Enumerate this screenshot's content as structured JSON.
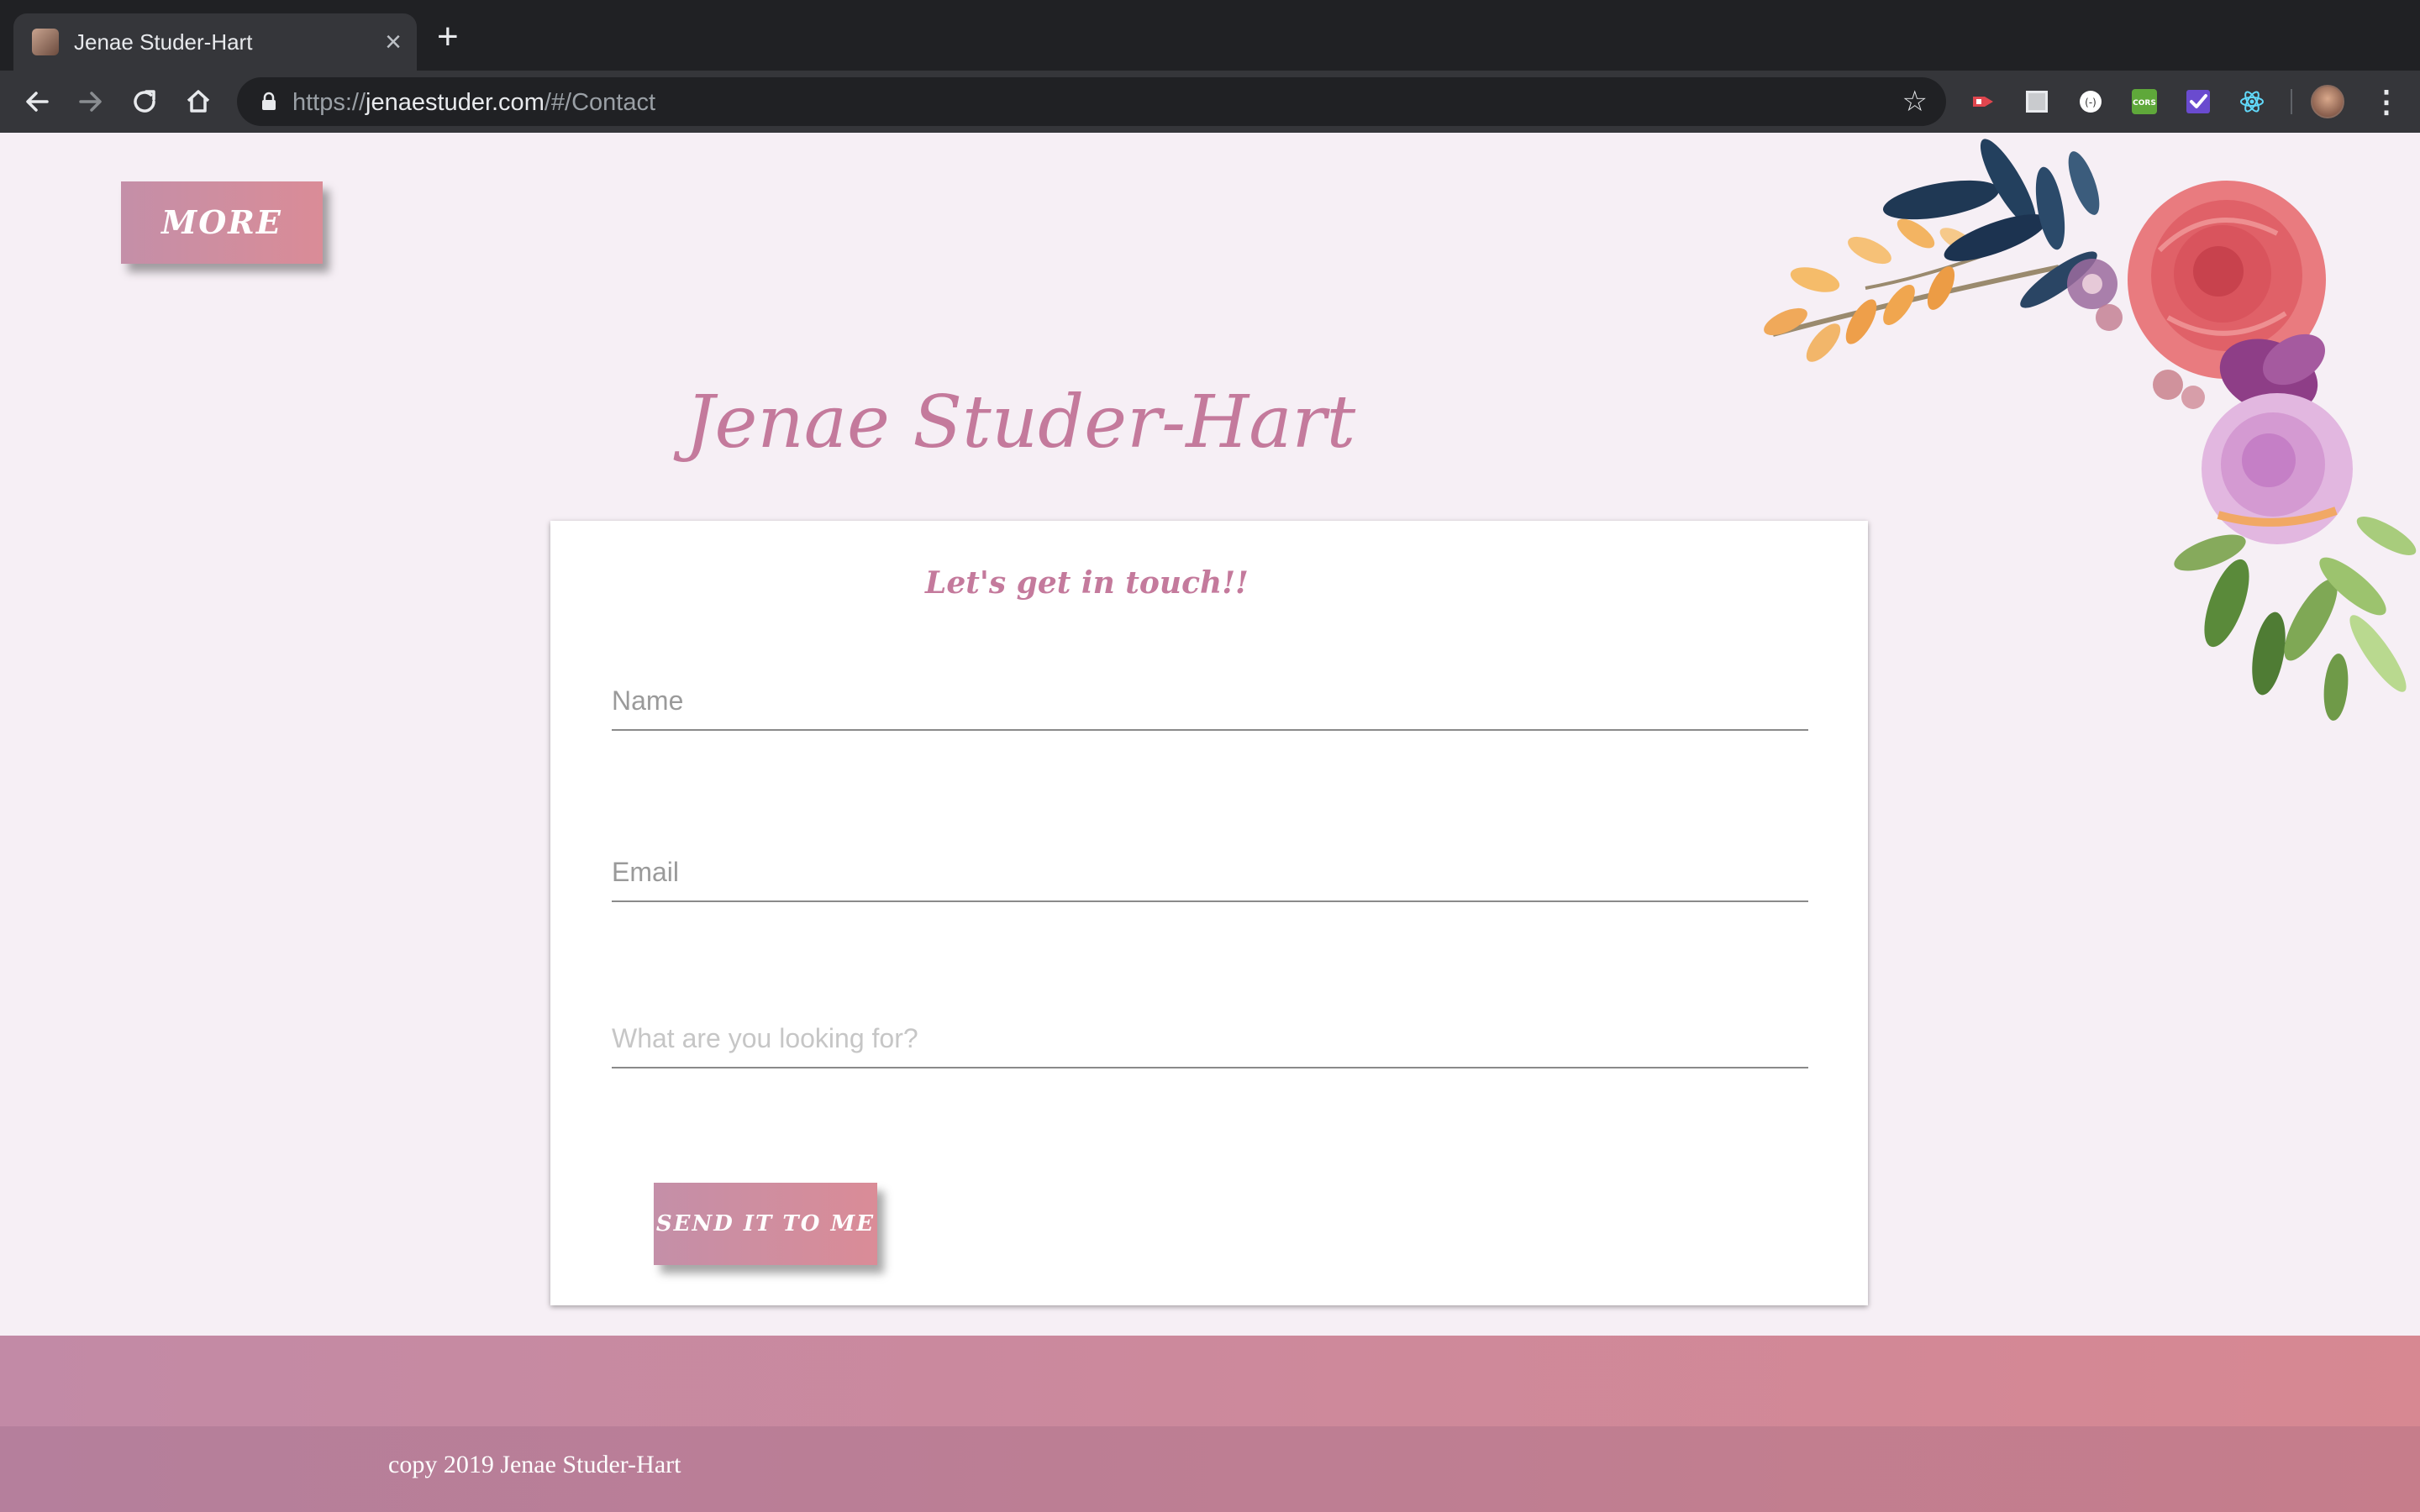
{
  "browser": {
    "tab_title": "Jenae Studer-Hart",
    "tab_close": "×",
    "new_tab": "+",
    "url_scheme": "https://",
    "url_host": "jenaestuder.com",
    "url_path": "/#/Contact",
    "icons": [
      "back-icon",
      "forward-icon",
      "reload-icon",
      "home-icon",
      "lock-icon",
      "star-icon",
      "kebab-menu-icon"
    ],
    "extensions": [
      {
        "name": "extension-red-arrow-icon",
        "color": "#e0464e"
      },
      {
        "name": "extension-white-square-icon",
        "color": "#e8eaed"
      },
      {
        "name": "extension-circle-icon",
        "color": "#ffffff"
      },
      {
        "name": "extension-cors-icon",
        "color": "#5fa83a",
        "label": "CORS"
      },
      {
        "name": "extension-purple-check-icon",
        "color": "#6a4bcf"
      },
      {
        "name": "extension-react-icon",
        "color": "#61dafb"
      }
    ]
  },
  "page": {
    "more_label": "MORE",
    "title": "Jenae Studer-Hart",
    "contact": {
      "heading": "Let's get in touch!!",
      "name_placeholder": "Name",
      "email_placeholder": "Email",
      "message_placeholder": "What are you looking for?",
      "send_label": "SEND IT TO ME"
    },
    "footer_text": "copy 2019 Jenae Studer-Hart"
  },
  "colors": {
    "accent": "#c47a9c",
    "button_gradient_start": "#c48fa8",
    "button_gradient_end": "#da8c97",
    "background": "#f6eff5"
  }
}
